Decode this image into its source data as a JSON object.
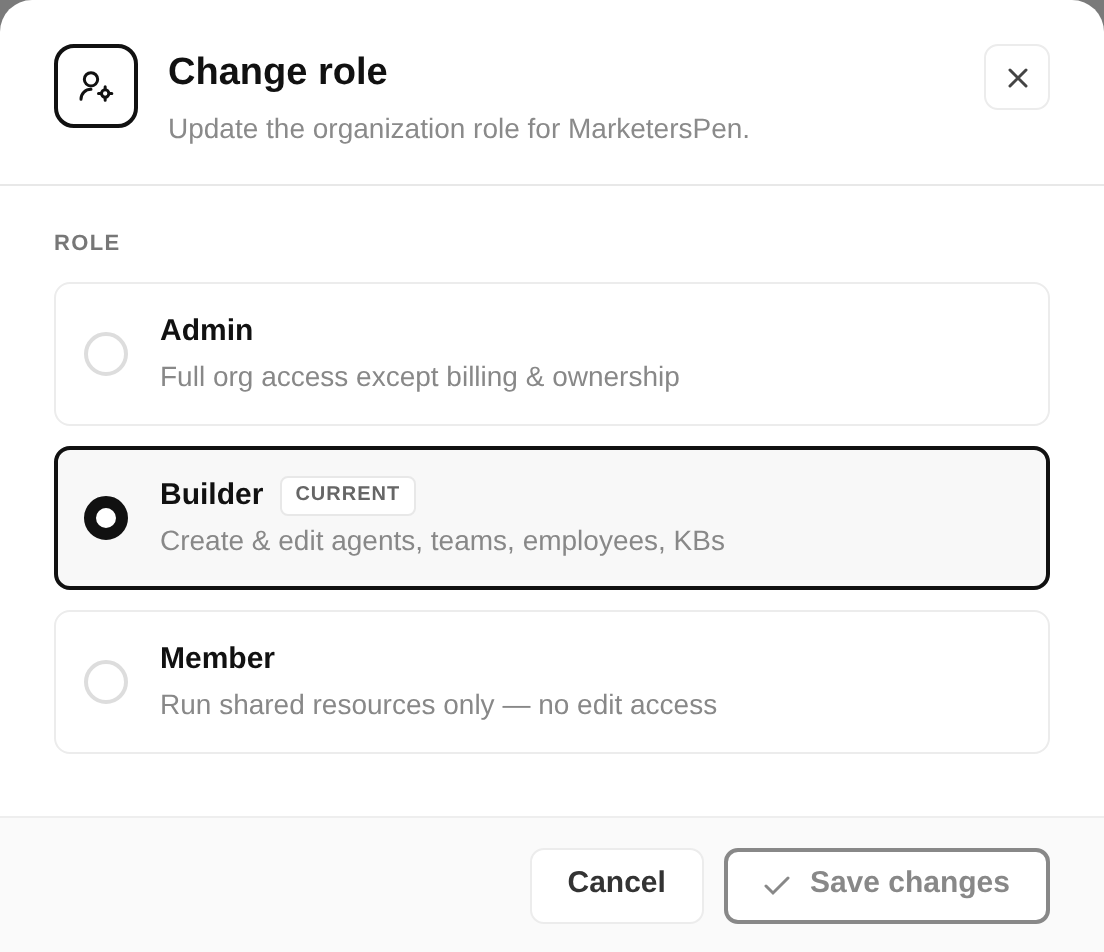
{
  "dialog": {
    "title": "Change role",
    "subtitle": "Update the organization role for MarketersPen."
  },
  "section_label": "ROLE",
  "roles": [
    {
      "name": "Admin",
      "description": "Full org access except billing & ownership",
      "selected": false
    },
    {
      "name": "Builder",
      "badge": "CURRENT",
      "description": "Create & edit agents, teams, employees, KBs",
      "selected": true
    },
    {
      "name": "Member",
      "description": "Run shared resources only — no edit access",
      "selected": false
    }
  ],
  "buttons": {
    "cancel": "Cancel",
    "save": {
      "label": "Save changes",
      "disabled": true
    }
  }
}
